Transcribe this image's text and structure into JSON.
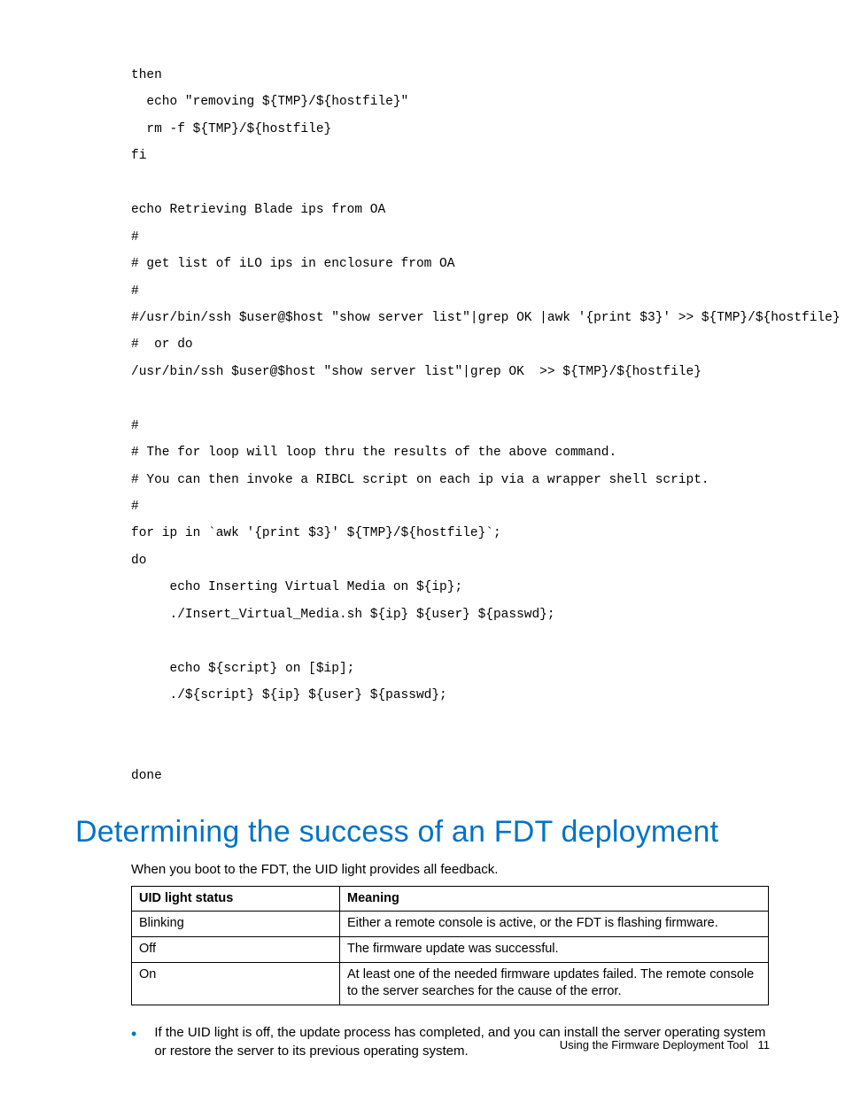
{
  "code": {
    "lines": [
      "then",
      "  echo \"removing ${TMP}/${hostfile}\"",
      "  rm -f ${TMP}/${hostfile}",
      "fi",
      "",
      "echo Retrieving Blade ips from OA",
      "#",
      "# get list of iLO ips in enclosure from OA",
      "#",
      "#/usr/bin/ssh $user@$host \"show server list\"|grep OK |awk '{print $3}' >> ${TMP}/${hostfile}",
      "#  or do",
      "/usr/bin/ssh $user@$host \"show server list\"|grep OK  >> ${TMP}/${hostfile}",
      "",
      "#",
      "# The for loop will loop thru the results of the above command.",
      "# You can then invoke a RIBCL script on each ip via a wrapper shell script.",
      "#",
      "for ip in `awk '{print $3}' ${TMP}/${hostfile}`;",
      "do",
      "     echo Inserting Virtual Media on ${ip};",
      "     ./Insert_Virtual_Media.sh ${ip} ${user} ${passwd};",
      "",
      "     echo ${script} on [$ip];",
      "     ./${script} ${ip} ${user} ${passwd};",
      "",
      "",
      "done"
    ]
  },
  "heading": "Determining the success of an FDT deployment",
  "intro": "When you boot to the FDT, the UID light provides all feedback.",
  "table": {
    "headers": [
      "UID light status",
      "Meaning"
    ],
    "rows": [
      [
        "Blinking",
        "Either a remote console is active, or the FDT is flashing firmware."
      ],
      [
        "Off",
        "The firmware update was successful."
      ],
      [
        "On",
        "At least one of the needed firmware updates failed. The remote console to the server searches for the cause of the error."
      ]
    ]
  },
  "bullets": [
    "If the UID light is off, the update process has completed, and you can install the server operating system or restore the server to its previous operating system."
  ],
  "footer": {
    "text": "Using the Firmware Deployment Tool",
    "page": "11"
  }
}
